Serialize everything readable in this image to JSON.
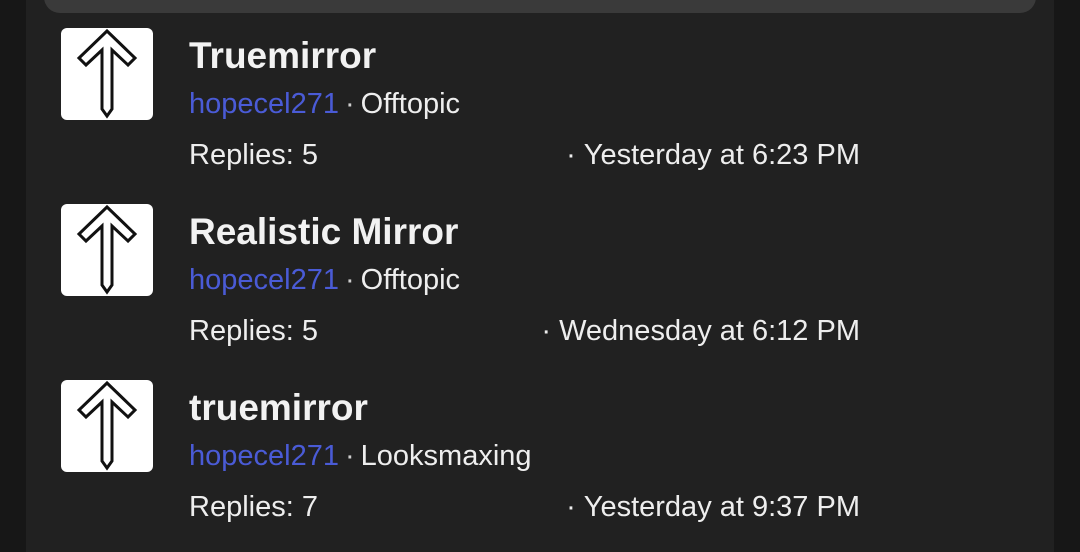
{
  "threads": [
    {
      "title": "Truemirror",
      "author": "hopecel271",
      "forum": "Offtopic",
      "replies": "Replies: 5",
      "last_activity": "Yesterday at 6:23 PM",
      "avatar_icon": "up-arrow-icon"
    },
    {
      "title": "Realistic Mirror",
      "author": "hopecel271",
      "forum": "Offtopic",
      "replies": "Replies: 5",
      "last_activity": "Wednesday at 6:12 PM",
      "avatar_icon": "up-arrow-icon"
    },
    {
      "title": "truemirror",
      "author": "hopecel271",
      "forum": "Looksmaxing",
      "replies": "Replies: 7",
      "last_activity": "Yesterday at 9:37 PM",
      "avatar_icon": "up-arrow-icon"
    }
  ],
  "separator": "·",
  "colors": {
    "background": "#171717",
    "panel": "#212121",
    "author_link": "#4a5bd6",
    "text": "#eeeeee"
  }
}
